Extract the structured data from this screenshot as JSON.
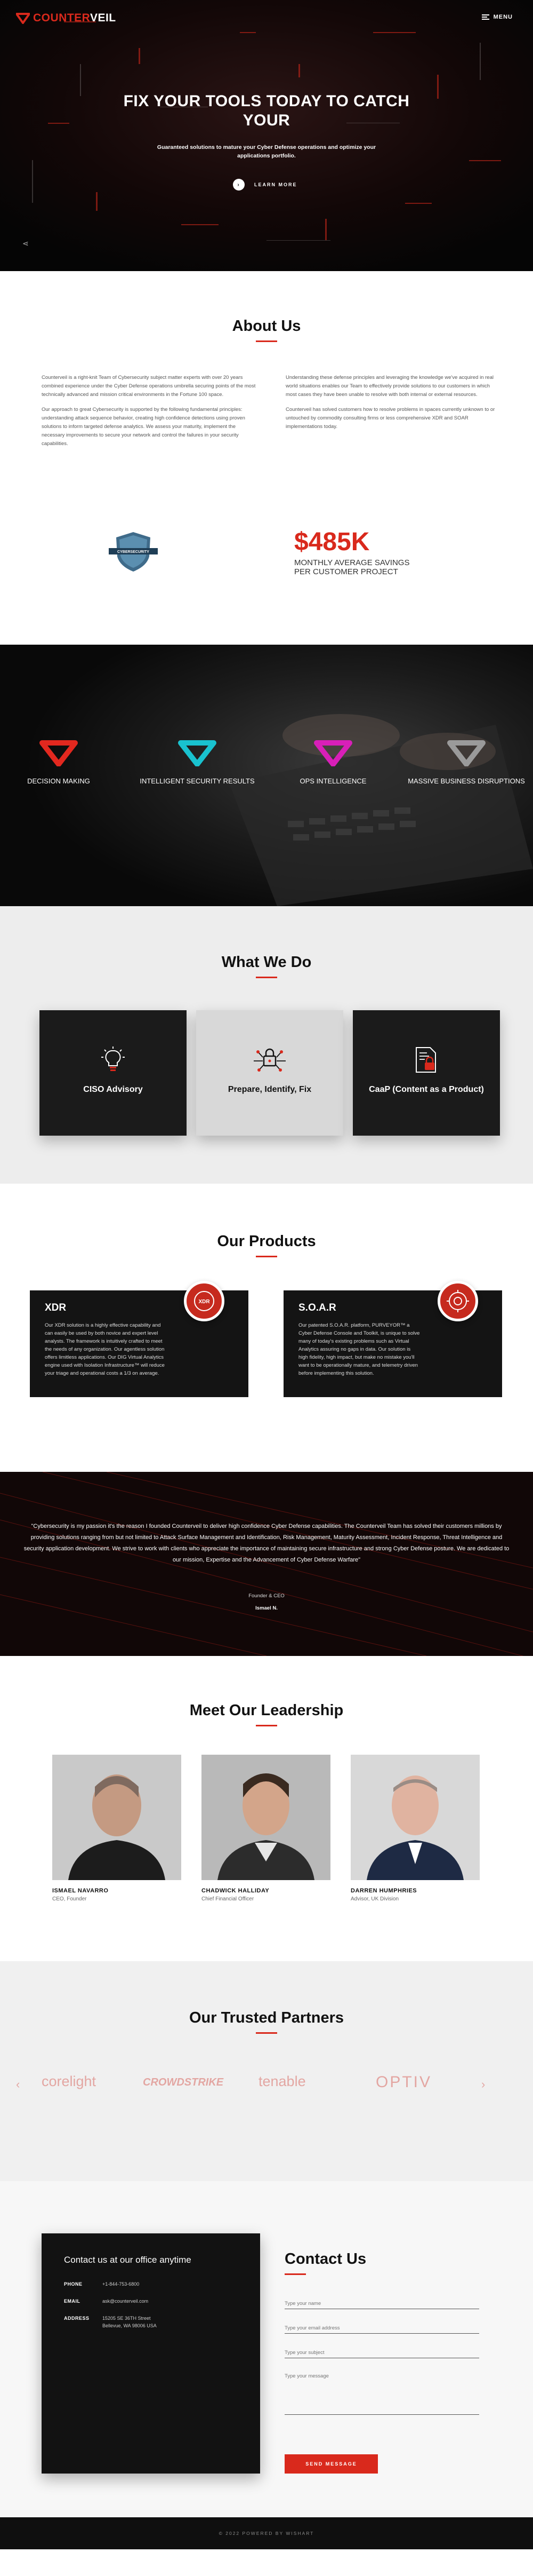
{
  "nav": {
    "logo_prefix": "COUNTER",
    "logo_suffix": "VEIL",
    "menu_label": "MENU"
  },
  "hero": {
    "title": "FIX YOUR TOOLS TODAY TO CATCH YOUR",
    "subtitle": "Guaranteed solutions to mature your Cyber Defense operations and optimize your applications portfolio.",
    "cta": "LEARN MORE"
  },
  "about": {
    "title": "About Us",
    "col1": [
      "Counterveil is a right-knit Team of Cybersecurity subject matter experts with over 20 years combined experience under the Cyber Defense operations umbrella securing points of the most technically advanced and mission critical environments in the Fortune 100 space.",
      "Our approach to great Cybersecurity is supported by the following fundamental principles: understanding attack sequence behavior, creating high confidence detections using proven solutions to inform targeted defense analytics. We assess your maturity, implement the necessary improvements to secure your network and control the failures in your security capabilities."
    ],
    "col2": [
      "Understanding these defense principles and leveraging the knowledge we've acquired in real world situations enables our Team to effectively provide solutions to our customers in which most cases they have been unable to resolve with both internal or external resources.",
      "Counterveil has solved customers how to resolve problems in spaces currently unknown to or untouched by commodity consulting firms or less comprehensive XDR and SOAR implementations today."
    ],
    "badge_text": "CYBERSECURITY",
    "savings_value": "$485K",
    "savings_caption_1": "MONTHLY AVERAGE SAVINGS",
    "savings_caption_2": "PER CUSTOMER PROJECT"
  },
  "banner": {
    "items": [
      {
        "label": "DECISION MAKING",
        "color": "#e2281f"
      },
      {
        "label": "INTELLIGENT SECURITY RESULTS",
        "color": "#19c2cf"
      },
      {
        "label": "OPS INTELLIGENCE",
        "color": "#d81fb8"
      },
      {
        "label": "MASSIVE BUSINESS DISRUPTIONS",
        "color": "#9a9a9a"
      }
    ]
  },
  "what_we_do": {
    "title": "What We Do",
    "cards": [
      {
        "label": "CISO Advisory",
        "icon": "lightbulb-icon"
      },
      {
        "label": "Prepare, Identify, Fix",
        "icon": "network-lock-icon"
      },
      {
        "label": "CaaP (Content as a Product)",
        "icon": "document-lock-icon"
      }
    ]
  },
  "products": {
    "title": "Our Products",
    "items": [
      {
        "name": "XDR",
        "badge": "XDR",
        "text": "Our XDR solution is a highly effective capability and can easily be used by both novice and expert level analysts. The framework is intuitively crafted to meet the needs of any organization. Our agentless solution offers limitless applications. Our DIG Virtual Analytics engine used with Isolation Infrastructure™ will reduce your triage and operational costs a 1/3 on average."
      },
      {
        "name": "S.O.A.R",
        "badge": "SOAR",
        "text": "Our patented S.O.A.R. platform, PURVEYOR™ a Cyber Defense Console and Toolkit, is unique to solve many of today's existing problems such as Virtual Analytics assuring no gaps in data. Our solution is high fidelity, high impact, but make no mistake you'll want to be operationally mature, and telemetry driven before implementing this solution."
      }
    ]
  },
  "quote": {
    "text": "\"Cybersecurity is my passion it's the reason I founded Counterveil to deliver high confidence Cyber Defense capabilities. The Counterveil Team has solved their customers millions by providing solutions ranging from but not limited to Attack Surface Management and Identification, Risk Management, Maturity Assessment, Incident Response, Threat Intelligence and security application development. We strive to work with clients who appreciate the importance of maintaining secure infrastructure and strong Cyber Defense posture. We are dedicated to our mission, Expertise and the Advancement of Cyber Defense Warfare\"",
    "role": "Founder & CEO",
    "name": "Ismael N."
  },
  "leadership": {
    "title": "Meet Our Leadership",
    "people": [
      {
        "name": "ISMAEL NAVARRO",
        "role": "CEO, Founder"
      },
      {
        "name": "CHADWICK HALLIDAY",
        "role": "Chief Financial Officer"
      },
      {
        "name": "DARREN HUMPHRIES",
        "role": "Advisor, UK Division"
      }
    ]
  },
  "partners": {
    "title": "Our Trusted Partners",
    "logos": [
      "corelight",
      "CROWDSTRIKE",
      "tenable",
      "OPTIV"
    ]
  },
  "contact": {
    "box_title": "Contact us at our office anytime",
    "rows": [
      {
        "key": "PHONE",
        "value": "+1-844-753-6800"
      },
      {
        "key": "EMAIL",
        "value": "ask@counterveil.com"
      },
      {
        "key": "ADDRESS",
        "value": "15205 SE 36TH Street Bellevue, WA 98006 USA"
      }
    ],
    "title": "Contact Us",
    "name_placeholder": "Type your name",
    "email_placeholder": "Type your email address",
    "subject_placeholder": "Type your subject",
    "message_placeholder": "Type your message",
    "send_label": "SEND MESSAGE"
  },
  "footer": {
    "text": "© 2022 POWERED BY WISHART"
  }
}
